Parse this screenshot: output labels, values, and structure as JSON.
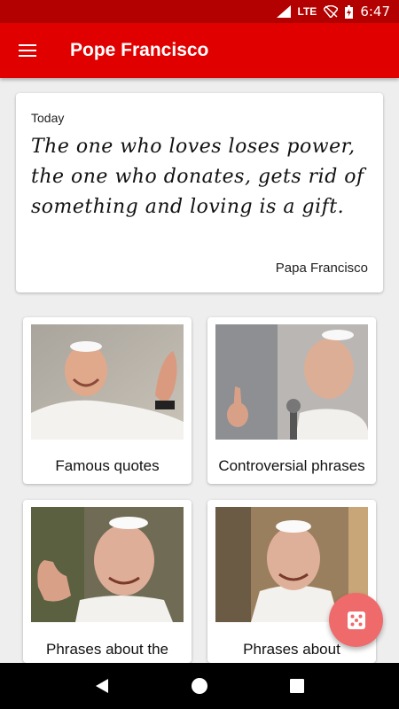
{
  "status_bar": {
    "network": "LTE",
    "time": "6:47"
  },
  "app_bar": {
    "title": "Pope Francisco"
  },
  "quote": {
    "label": "Today",
    "text": "The one who loves loses power,\nthe one who donates, gets rid of\nsomething and loving is a gift.",
    "author": "Papa Francisco"
  },
  "categories": [
    {
      "label": "Famous quotes"
    },
    {
      "label": "Controversial phrases"
    },
    {
      "label": "Phrases about the family"
    },
    {
      "label": "Phrases about Christianity"
    }
  ],
  "colors": {
    "status_bar": "#b30000",
    "app_bar": "#e00000",
    "fab": "#ef6a6a",
    "background": "#eeeeee"
  },
  "icons": {
    "menu": "hamburger-menu-icon",
    "fab": "dice-icon",
    "back": "back-triangle-icon",
    "home": "home-circle-icon",
    "recents": "recents-square-icon"
  }
}
